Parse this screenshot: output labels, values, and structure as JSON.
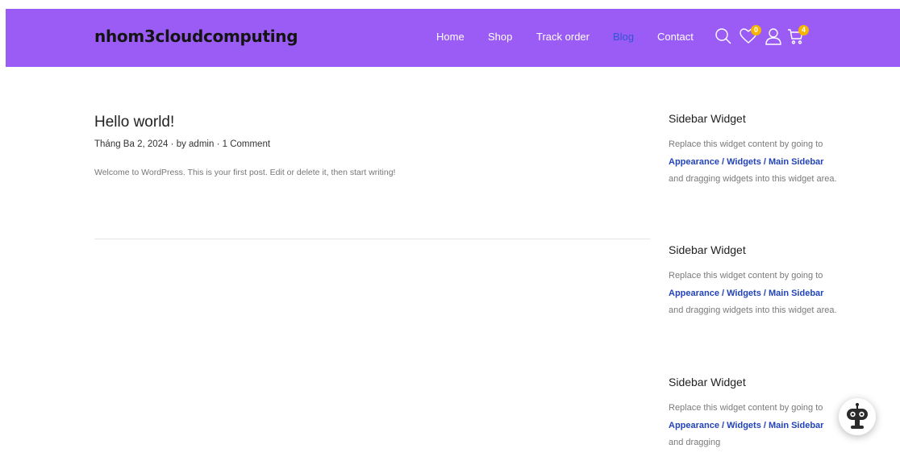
{
  "header": {
    "brand": "nhom3cloudcomputing",
    "nav": [
      "Home",
      "Shop",
      "Track order",
      "Blog",
      "Contact"
    ],
    "active_nav": "Blog",
    "icons": [
      "search-icon",
      "heart-icon",
      "user-icon",
      "cart-icon"
    ],
    "wishlist_count": "0",
    "cart_count": "4",
    "colors": {
      "header_bg": "#9b5cf6",
      "nav_text": "#ffffff",
      "nav_active": "#2f55d4",
      "badge": "#f5b400"
    }
  },
  "post": {
    "title": "Hello world!",
    "date": "Tháng Ba 2, 2024",
    "sep1": "·",
    "author": "by admin",
    "sep2": "·",
    "comments": "1 Comment",
    "excerpt": "Welcome to WordPress. This is your first post. Edit or delete it, then start writing!"
  },
  "sidebar": {
    "widgets": [
      {
        "title": "Sidebar Widget",
        "text_before": "Replace this widget content by going to",
        "link": "Appearance / Widgets / Main Sidebar",
        "text_after": "and dragging widgets into this widget area."
      },
      {
        "title": "Sidebar Widget",
        "text_before": "Replace this widget content by going to",
        "link": "Appearance / Widgets / Main Sidebar",
        "text_after": "and dragging widgets into this widget area."
      },
      {
        "title": "Sidebar Widget",
        "text_before": "Replace this widget content by going to",
        "link": "Appearance / Widgets / Main Sidebar",
        "text_after": "and dragging"
      }
    ],
    "link_color": "#2343b8"
  },
  "chatbot": {
    "icon": "robot-icon"
  }
}
